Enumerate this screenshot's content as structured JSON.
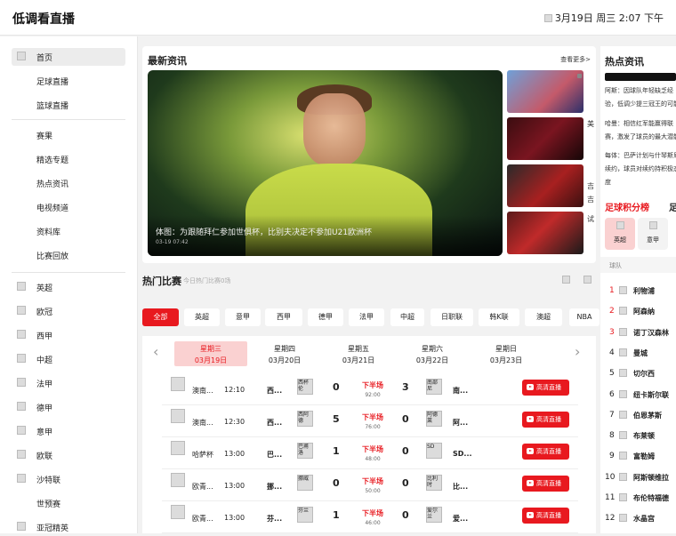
{
  "header": {
    "logo": "低调看直播",
    "datetime": "3月19日 周三 2:07 下午"
  },
  "sidebar": {
    "items": [
      {
        "label": "首页",
        "icon": "home-icon",
        "active": true
      },
      {
        "label": "足球直播"
      },
      {
        "label": "篮球直播"
      },
      {
        "label": "赛果"
      },
      {
        "label": "精选专题"
      },
      {
        "label": "热点资讯"
      },
      {
        "label": "电视频道"
      },
      {
        "label": "资料库"
      },
      {
        "label": "比赛回放"
      },
      {
        "label": "英超",
        "icon": "premier-league-icon"
      },
      {
        "label": "欧冠",
        "icon": "champions-league-icon"
      },
      {
        "label": "西甲",
        "icon": "laliga-icon"
      },
      {
        "label": "中超",
        "icon": "csl-icon"
      },
      {
        "label": "法甲",
        "icon": "ligue1-icon"
      },
      {
        "label": "德甲",
        "icon": "bundesliga-icon"
      },
      {
        "label": "意甲",
        "icon": "serie-a-icon"
      },
      {
        "label": "欧联",
        "icon": "europa-league-icon"
      },
      {
        "label": "沙特联",
        "icon": "saudi-league-icon"
      },
      {
        "label": "世预赛"
      },
      {
        "label": "亚冠精英",
        "icon": "afc-icon"
      }
    ]
  },
  "news": {
    "title": "最新资讯",
    "more": "查看更多>",
    "hero": {
      "caption": "体图：为跟随拜仁参加世俱杯，比别夫决定不参加U21欧洲杯",
      "time": "03-19 07:42"
    },
    "side_chars": [
      "美",
      "吉",
      "吉",
      "试"
    ]
  },
  "hot_news": {
    "title": "热点资讯",
    "items": [
      "阿斯：因球队年轻缺乏经验，低调少提三冠王的可能",
      "哈曼：相信红军能赢得联赛，激发了球员的最大潜能",
      "每体：巴萨计划与什琴斯尼续约，球员对续约持积极态度"
    ]
  },
  "standings": {
    "title": "足球积分榜",
    "title2": "足",
    "tabs": [
      "英超",
      "意甲"
    ],
    "team_header": "球队",
    "teams": [
      {
        "rank": "1",
        "name": "利物浦",
        "color": "#e8191f"
      },
      {
        "rank": "2",
        "name": "阿森纳",
        "color": "#e8191f"
      },
      {
        "rank": "3",
        "name": "诺丁汉森林",
        "color": "#e8191f"
      },
      {
        "rank": "4",
        "name": "曼城",
        "color": "#222222"
      },
      {
        "rank": "5",
        "name": "切尔西",
        "color": "#222222"
      },
      {
        "rank": "6",
        "name": "纽卡斯尔联",
        "color": "#222222"
      },
      {
        "rank": "7",
        "name": "伯恩茅斯",
        "color": "#222222"
      },
      {
        "rank": "8",
        "name": "布莱顿",
        "color": "#222222"
      },
      {
        "rank": "9",
        "name": "富勒姆",
        "color": "#222222"
      },
      {
        "rank": "10",
        "name": "阿斯顿维拉",
        "color": "#222222"
      },
      {
        "rank": "11",
        "name": "布伦特福德",
        "color": "#222222"
      },
      {
        "rank": "12",
        "name": "水晶宫",
        "color": "#222222"
      }
    ]
  },
  "hot_matches": {
    "title": "热门比赛",
    "subtitle": "今日热门比赛0场",
    "filters": [
      "全部",
      "英超",
      "意甲",
      "西甲",
      "德甲",
      "法甲",
      "中超",
      "日职联",
      "韩K联",
      "澳超",
      "NBA"
    ],
    "days": [
      {
        "week": "星期三",
        "date": "03月19日",
        "active": true
      },
      {
        "week": "星期四",
        "date": "03月20日"
      },
      {
        "week": "星期五",
        "date": "03月21日"
      },
      {
        "week": "星期六",
        "date": "03月22日"
      },
      {
        "week": "星期日",
        "date": "03月23日"
      }
    ],
    "rows": [
      {
        "league": "澳南...",
        "time": "12:10",
        "home": "西...",
        "home_logo": "西杯伦",
        "home_score": "0",
        "status": "下半场",
        "status_time": "92:00",
        "away_score": "3",
        "away_logo": "南部尼",
        "away": "南...",
        "button": "高清直播"
      },
      {
        "league": "澳南...",
        "time": "12:30",
        "home": "西...",
        "home_logo": "西阿德",
        "home_score": "5",
        "status": "下半场",
        "status_time": "76:00",
        "away_score": "0",
        "away_logo": "阿德莱",
        "away": "阿...",
        "button": "高清直播"
      },
      {
        "league": "哈萨杯",
        "time": "13:00",
        "home": "巴...",
        "home_logo": "巴甫洛",
        "home_score": "1",
        "status": "下半场",
        "status_time": "48:00",
        "away_score": "0",
        "away_logo": "SD",
        "away": "SD...",
        "button": "高清直播"
      },
      {
        "league": "欧青...",
        "time": "13:00",
        "home": "挪...",
        "home_logo": "挪威",
        "home_score": "0",
        "status": "下半场",
        "status_time": "50:00",
        "away_score": "0",
        "away_logo": "比利时",
        "away": "比...",
        "button": "高清直播"
      },
      {
        "league": "欧青...",
        "time": "13:00",
        "home": "芬...",
        "home_logo": "芬兰",
        "home_score": "1",
        "status": "下半场",
        "status_time": "46:00",
        "away_score": "0",
        "away_logo": "爱尔兰",
        "away": "爱...",
        "button": "高清直播"
      }
    ]
  }
}
